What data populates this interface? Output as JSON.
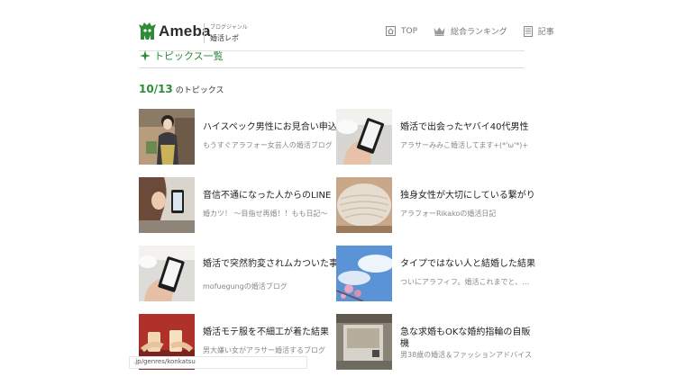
{
  "header": {
    "logo_text": "Ameba",
    "logo_sub_small": "ブログジャンル",
    "logo_sub_main": "婚活レポ",
    "nav": [
      {
        "label": "TOP",
        "icon": "home-icon"
      },
      {
        "label": "総合ランキング",
        "icon": "crown-icon"
      },
      {
        "label": "記事ランキング",
        "icon": "document-icon"
      }
    ]
  },
  "section": {
    "title": "トピックス一覧"
  },
  "date": {
    "number": "10/13",
    "suffix": "のトピックス"
  },
  "items": [
    {
      "title": "ハイスペック男性にお見合い申込",
      "sub": "もうすぐアラフォー女芸人の婚活ブログ"
    },
    {
      "title": "婚活で出会ったヤバイ40代男性",
      "sub": "アラサーみみこ婚活してます+(*'ω'*)+"
    },
    {
      "title": "音信不通になった人からのLINE",
      "sub": "婚カツ！ 〜目指せ再婚！！もも日記〜"
    },
    {
      "title": "独身女性が大切にしている繋がり",
      "sub": "アラフォーRikakoの婚活日記"
    },
    {
      "title": "婚活で突然豹変されムカついた事",
      "sub": "mofuegungの婚活ブログ"
    },
    {
      "title": "タイプではない人と結婚した結果",
      "sub": "ついにアラフィフ。婚活これまでと、これから"
    },
    {
      "title": "婚活モテ服を不細工が着た結果",
      "sub": "男大嫌い女がアラサー婚活するブログ"
    },
    {
      "title": "急な求婚もOKな婚約指輪の自販機",
      "sub": "男38歳の婚活＆ファッションアドバイス"
    }
  ],
  "status_bar": {
    "url": ".jp/genres/konkatsu"
  },
  "colors": {
    "brand_green": "#2e8b38",
    "text": "#222222",
    "muted": "#888888"
  }
}
